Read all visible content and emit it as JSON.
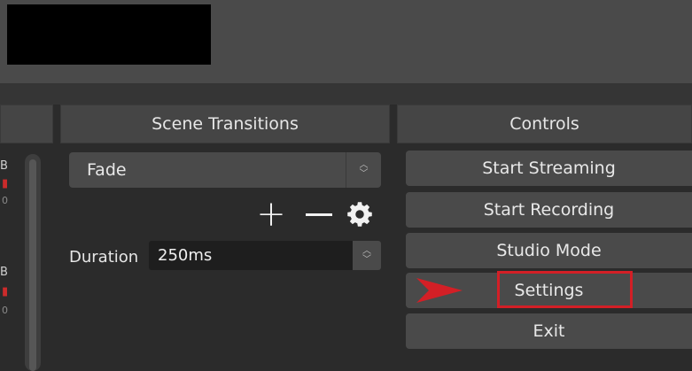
{
  "scene_transitions": {
    "header": "Scene Transitions",
    "transition_select": {
      "value": "Fade"
    },
    "add_icon": "plus-icon",
    "remove_icon": "minus-icon",
    "properties_icon": "gear-icon",
    "duration": {
      "label": "Duration",
      "value": "250ms"
    }
  },
  "controls": {
    "header": "Controls",
    "buttons": [
      {
        "label": "Start Streaming"
      },
      {
        "label": "Start Recording"
      },
      {
        "label": "Studio Mode"
      },
      {
        "label": "Settings"
      },
      {
        "label": "Exit"
      }
    ]
  },
  "annotation": {
    "arrow_color": "#d31f26",
    "box_color": "#d31f26"
  },
  "mixer_fragments": {
    "top_char": "B",
    "top_sub": "0",
    "bottom_char": "B",
    "bottom_sub": "0"
  }
}
